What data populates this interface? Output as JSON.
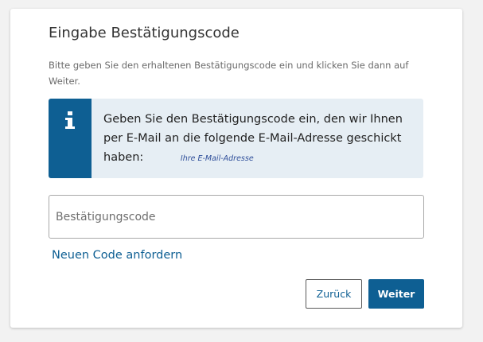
{
  "card": {
    "title": "Eingabe Bestätigungscode",
    "subtitle": "Bitte geben Sie den erhaltenen Bestätigungscode ein und klicken Sie dann auf Weiter."
  },
  "info": {
    "icon": "info-icon",
    "text": "Geben Sie den Bestätigungscode ein, den wir Ihnen per E-Mail an die folgende E-Mail-Adresse geschickt haben:",
    "email_placeholder": "Ihre E-Mail-Adresse"
  },
  "form": {
    "code_placeholder": "Bestätigungscode",
    "code_value": "",
    "resend_link": "Neuen Code anfordern"
  },
  "buttons": {
    "back": "Zurück",
    "next": "Weiter"
  },
  "colors": {
    "accent": "#0e5f93",
    "info_bg": "#e6eef4",
    "page_bg": "#f2f2f2"
  }
}
